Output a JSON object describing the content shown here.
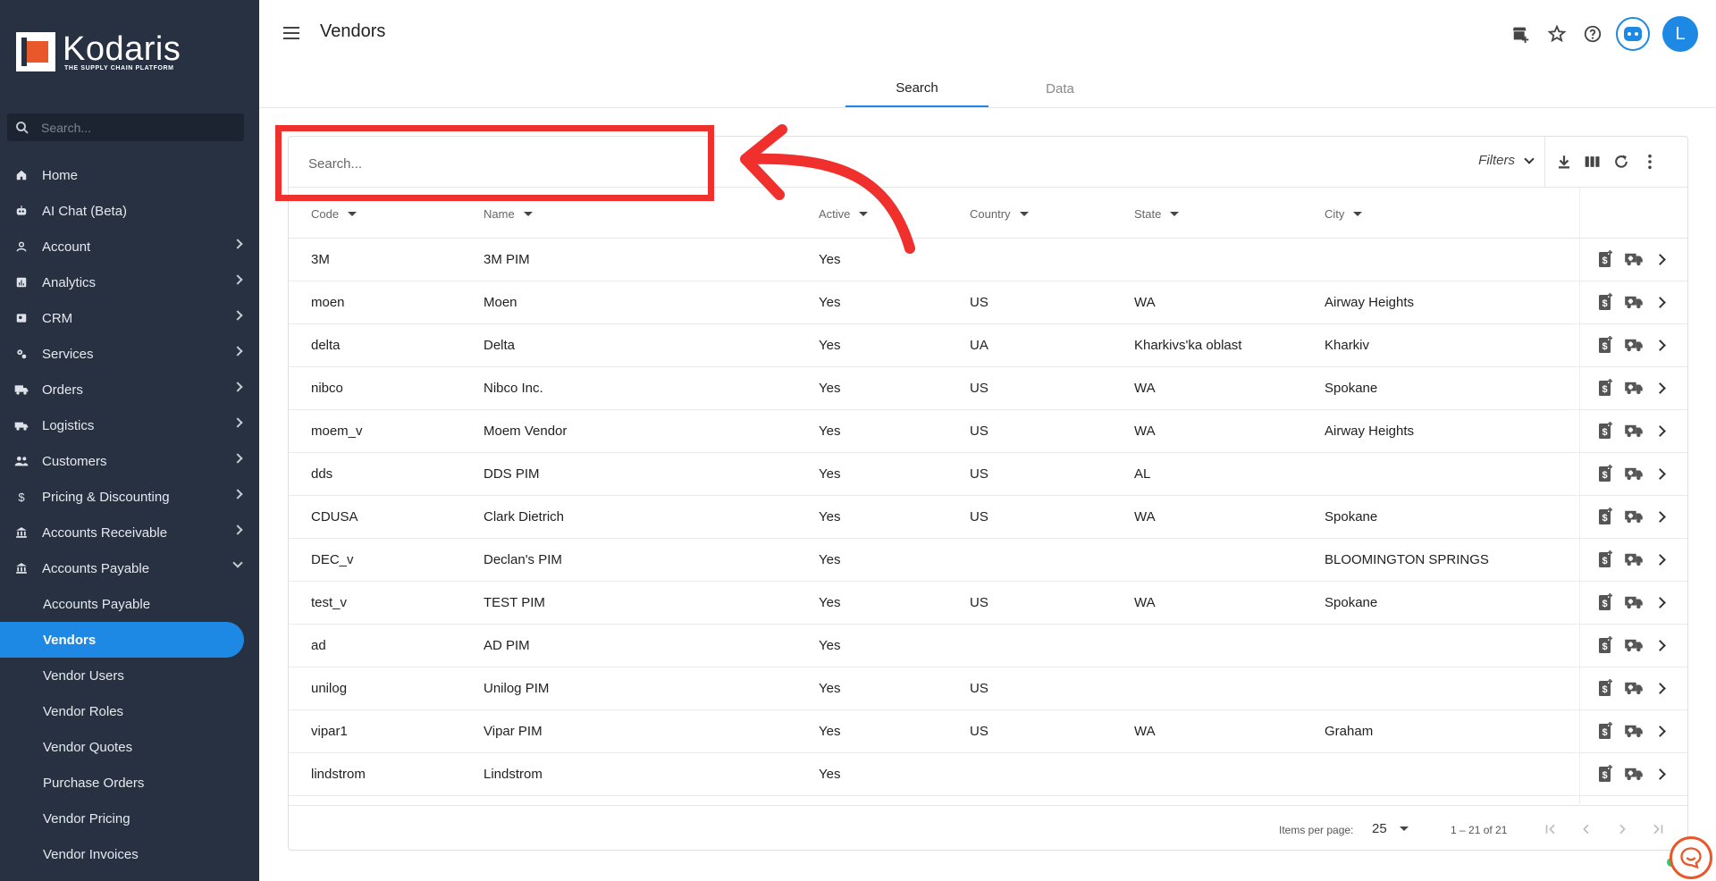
{
  "app": {
    "logo_name": "Kodaris",
    "logo_tagline": "THE SUPPLY CHAIN PLATFORM",
    "page_title": "Vendors",
    "avatar_initial": "L"
  },
  "sidebar": {
    "search_placeholder": "Search...",
    "items": [
      {
        "label": "Home",
        "icon": "home-icon"
      },
      {
        "label": "AI Chat (Beta)",
        "icon": "robot-icon"
      },
      {
        "label": "Account",
        "icon": "person-icon"
      },
      {
        "label": "Analytics",
        "icon": "analytics-icon"
      },
      {
        "label": "CRM",
        "icon": "contact-card-icon"
      },
      {
        "label": "Services",
        "icon": "gears-icon"
      },
      {
        "label": "Orders",
        "icon": "truck-icon"
      },
      {
        "label": "Logistics",
        "icon": "logistics-icon"
      },
      {
        "label": "Customers",
        "icon": "people-icon"
      },
      {
        "label": "Pricing & Discounting",
        "icon": "dollar-icon"
      },
      {
        "label": "Accounts Receivable",
        "icon": "bank-icon"
      },
      {
        "label": "Accounts Payable",
        "icon": "bank-icon"
      }
    ],
    "sub_items": [
      {
        "label": "Accounts Payable"
      },
      {
        "label": "Vendors"
      },
      {
        "label": "Vendor Users"
      },
      {
        "label": "Vendor Roles"
      },
      {
        "label": "Vendor Quotes"
      },
      {
        "label": "Purchase Orders"
      },
      {
        "label": "Vendor Pricing"
      },
      {
        "label": "Vendor Invoices"
      }
    ]
  },
  "tabs": [
    {
      "label": "Search"
    },
    {
      "label": "Data"
    }
  ],
  "toolbar": {
    "search_placeholder": "Search...",
    "filters_label": "Filters"
  },
  "table": {
    "columns": [
      "Code",
      "Name",
      "Active",
      "Country",
      "State",
      "City"
    ],
    "rows": [
      {
        "code": "3M",
        "name": "3M PIM",
        "active": "Yes",
        "country": "",
        "state": "",
        "city": ""
      },
      {
        "code": "moen",
        "name": "Moen",
        "active": "Yes",
        "country": "US",
        "state": "WA",
        "city": "Airway Heights"
      },
      {
        "code": "delta",
        "name": "Delta",
        "active": "Yes",
        "country": "UA",
        "state": "Kharkivs'ka oblast",
        "city": "Kharkiv"
      },
      {
        "code": "nibco",
        "name": "Nibco Inc.",
        "active": "Yes",
        "country": "US",
        "state": "WA",
        "city": "Spokane"
      },
      {
        "code": "moem_v",
        "name": "Moem Vendor",
        "active": "Yes",
        "country": "US",
        "state": "WA",
        "city": "Airway Heights"
      },
      {
        "code": "dds",
        "name": "DDS PIM",
        "active": "Yes",
        "country": "US",
        "state": "AL",
        "city": ""
      },
      {
        "code": "CDUSA",
        "name": "Clark Dietrich",
        "active": "Yes",
        "country": "US",
        "state": "WA",
        "city": "Spokane"
      },
      {
        "code": "DEC_v",
        "name": "Declan's PIM",
        "active": "Yes",
        "country": "",
        "state": "",
        "city": "BLOOMINGTON SPRINGS"
      },
      {
        "code": "test_v",
        "name": "TEST PIM",
        "active": "Yes",
        "country": "US",
        "state": "WA",
        "city": "Spokane"
      },
      {
        "code": "ad",
        "name": "AD PIM",
        "active": "Yes",
        "country": "",
        "state": "",
        "city": ""
      },
      {
        "code": "unilog",
        "name": "Unilog PIM",
        "active": "Yes",
        "country": "US",
        "state": "",
        "city": ""
      },
      {
        "code": "vipar1",
        "name": "Vipar PIM",
        "active": "Yes",
        "country": "US",
        "state": "WA",
        "city": "Graham"
      },
      {
        "code": "lindstrom",
        "name": "Lindstrom",
        "active": "Yes",
        "country": "",
        "state": "",
        "city": ""
      }
    ]
  },
  "paginator": {
    "items_per_page_label": "Items per page:",
    "page_size": "25",
    "range_label": "1 – 21 of 21"
  },
  "colors": {
    "sidebar_bg": "#273142",
    "accent": "#1e88e5",
    "annotation": "#f0302d",
    "brand": "#e8582a"
  }
}
